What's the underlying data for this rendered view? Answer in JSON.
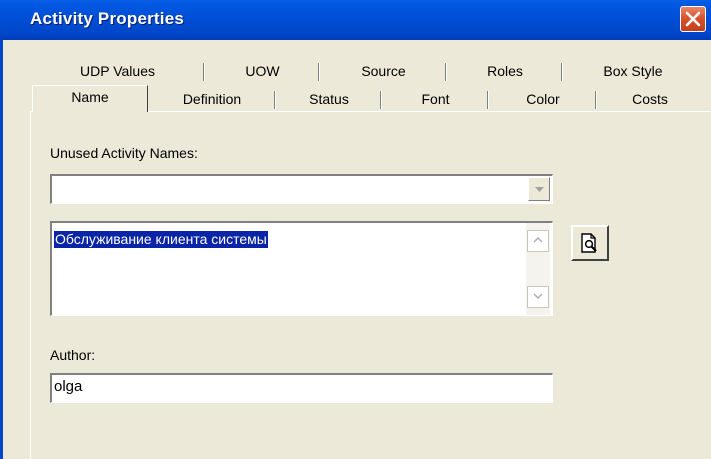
{
  "window": {
    "title": "Activity Properties"
  },
  "tabs_row1": [
    "UDP Values",
    "UOW",
    "Source",
    "Roles",
    "Box Style"
  ],
  "tabs_row2": [
    "Name",
    "Definition",
    "Status",
    "Font",
    "Color",
    "Costs"
  ],
  "active_tab": "Name",
  "unused_names": {
    "label": "Unused Activity Names:",
    "value": ""
  },
  "activity_name": {
    "value": "Обслуживание клиента системы"
  },
  "author": {
    "label": "Author:",
    "value": "olga"
  },
  "icons": {
    "close": "close-icon",
    "preview": "document-preview-icon",
    "dropdown": "chevron-down-icon"
  }
}
